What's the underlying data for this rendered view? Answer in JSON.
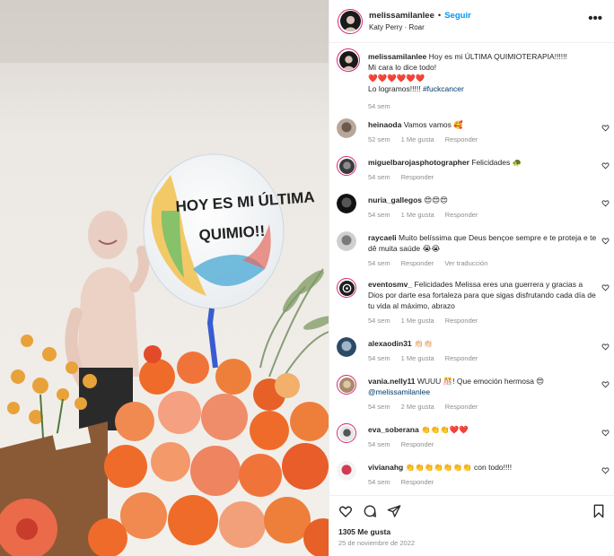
{
  "header": {
    "username": "melissamilanlee",
    "dot": "•",
    "follow_label": "Seguir",
    "song": "Katy Perry · Roar",
    "more_label": "•••"
  },
  "caption": {
    "username": "melissamilanlee",
    "line1": "Hoy es mi ÚLTIMA QUIMIOTERAPIA!!!!!!",
    "line2": "Mi cara lo dice todo!",
    "hearts": "❤️❤️❤️❤️❤️❤️",
    "line4_text": "Lo logramos!!!!! ",
    "line4_tag": "#fuckcancer",
    "time": "54 sem"
  },
  "photo": {
    "balloon_line1": "HOY ES MI ÚLTIMA",
    "balloon_line2": "QUIMIO!!"
  },
  "comments": [
    {
      "user": "heinaoda",
      "text": "Vamos vamos 🥰",
      "time": "52 sem",
      "likes": "1 Me gusta",
      "reply": "Responder",
      "extra": ""
    },
    {
      "user": "miguelbarojasphotographer",
      "text": "Felicidades 🐢",
      "time": "54 sem",
      "likes": "",
      "reply": "Responder",
      "extra": ""
    },
    {
      "user": "nuria_gallegos",
      "text": "😍😍😍",
      "time": "54 sem",
      "likes": "1 Me gusta",
      "reply": "Responder",
      "extra": ""
    },
    {
      "user": "raycaeli",
      "text": "Muito belíssima que Deus bençoe sempre e te proteja e te dê muita saúde 😭😭",
      "time": "54 sem",
      "likes": "",
      "reply": "Responder",
      "extra": "Ver traducción"
    },
    {
      "user": "eventosmv_",
      "text": "Felicidades Melissa eres una guerrera y gracias a Dios por darte esa fortaleza para que sigas disfrutando cada día de tu vida al máximo, abrazo",
      "time": "54 sem",
      "likes": "1 Me gusta",
      "reply": "Responder",
      "extra": ""
    },
    {
      "user": "alexaodin31",
      "text": "👏🏻👏🏻",
      "time": "54 sem",
      "likes": "1 Me gusta",
      "reply": "Responder",
      "extra": ""
    },
    {
      "user": "vania.nelly11",
      "text": "WUUU 🎊! Que emoción hermosa 😍",
      "tag": "@melissamilanlee",
      "time": "54 sem",
      "likes": "2 Me gusta",
      "reply": "Responder",
      "extra": ""
    },
    {
      "user": "eva_soberana",
      "text": "👏👏👏❤️❤️",
      "time": "54 sem",
      "likes": "",
      "reply": "Responder",
      "extra": ""
    },
    {
      "user": "vivianahg",
      "text": "👏👏👏👏👏👏👏 con todo!!!!",
      "time": "54 sem",
      "likes": "",
      "reply": "Responder",
      "extra": ""
    }
  ],
  "footer": {
    "likes": "1305 Me gusta",
    "date": "25 de noviembre de 2022"
  },
  "icons": {
    "like": "heart-icon",
    "comment": "comment-icon",
    "share": "share-icon",
    "save": "bookmark-icon",
    "more": "more-icon"
  },
  "colors": {
    "follow": "#0095f6",
    "hashtag": "#00376b",
    "muted": "#8e8e8e",
    "story_ring": "#d62976"
  }
}
